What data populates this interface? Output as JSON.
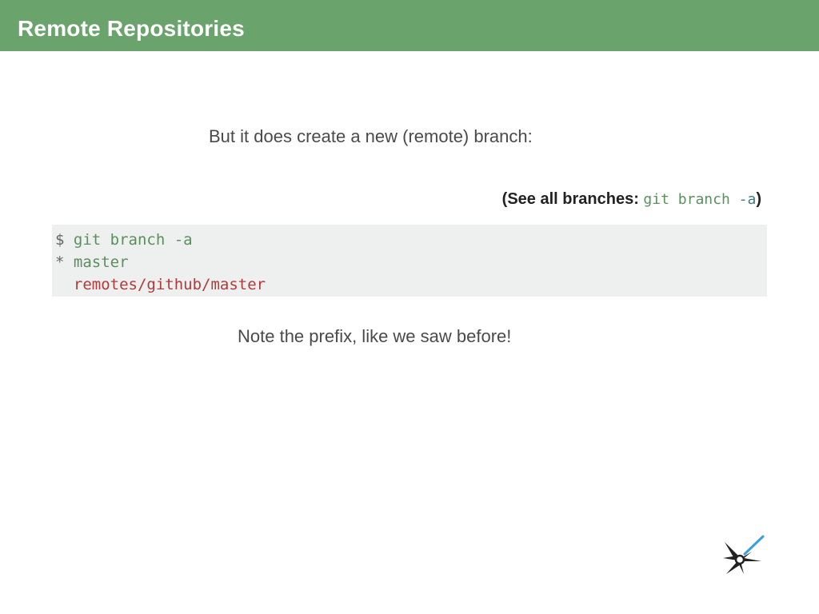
{
  "header": {
    "title": "Remote Repositories",
    "background": "#6aa46c"
  },
  "slide": {
    "intro": "But it does create a new (remote) branch:",
    "hint": {
      "open": "(",
      "label": "See all branches:",
      "code_cmd": "git branch ",
      "code_flag": "-a",
      "close": ")"
    },
    "code": {
      "line1": {
        "prompt": "$",
        "command": "git branch -a"
      },
      "line2": {
        "marker": "*",
        "branch": "master"
      },
      "line3": {
        "indent": " ",
        "branch": "remotes/github/master"
      }
    },
    "note": "Note the prefix, like we saw before!"
  },
  "colors": {
    "code_green": "#5a8f5e",
    "code_red": "#b03a3a",
    "code_bg": "#eeefef",
    "logo_blue": "#3aa0d8"
  },
  "icons": {
    "corner_logo": "compass-star-icon"
  }
}
